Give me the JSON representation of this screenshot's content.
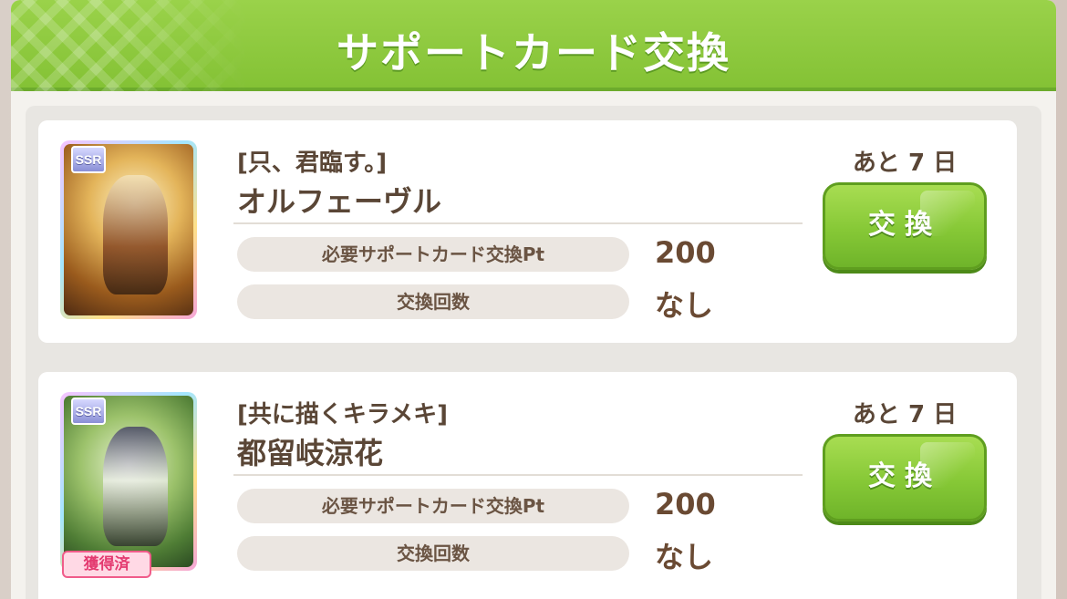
{
  "header": {
    "title": "サポートカード交換"
  },
  "cards": [
    {
      "rarity": "SSR",
      "subtitle": "[只、君臨す。]",
      "name": "オルフェーヴル",
      "required_label": "必要サポートカード交換Pt",
      "required_value": "200",
      "count_label": "交換回数",
      "count_value": "なし",
      "remaining": "あと 7 日",
      "button_label": "交換",
      "owned": false
    },
    {
      "rarity": "SSR",
      "subtitle": "[共に描くキラメキ]",
      "name": "都留岐涼花",
      "required_label": "必要サポートカード交換Pt",
      "required_value": "200",
      "count_label": "交換回数",
      "count_value": "なし",
      "remaining": "あと 7 日",
      "button_label": "交換",
      "owned": true,
      "owned_label": "獲得済"
    }
  ]
}
